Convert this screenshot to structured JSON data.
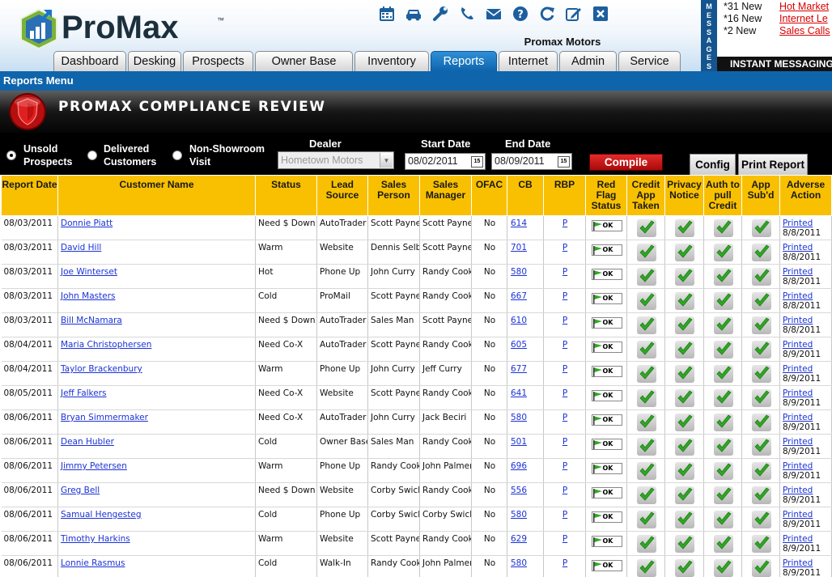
{
  "app": {
    "logo": "ProMax",
    "logo_tm": "™",
    "dealer_name": "Promax Motors"
  },
  "toolbar_icons": [
    "calendar-icon",
    "car-icon",
    "wrench-icon",
    "phone-icon",
    "mail-icon",
    "help-icon",
    "refresh-icon",
    "edit-icon",
    "close-icon"
  ],
  "tabs": [
    {
      "label": "Dashboard",
      "active": false
    },
    {
      "label": "Desking",
      "active": false
    },
    {
      "label": "Prospects",
      "active": false
    },
    {
      "label": "Owner Base",
      "active": false
    },
    {
      "label": "Inventory",
      "active": false
    },
    {
      "label": "Reports",
      "active": true
    },
    {
      "label": "Internet",
      "active": false
    },
    {
      "label": "Admin",
      "active": false
    },
    {
      "label": "Service",
      "active": false
    }
  ],
  "messages": {
    "vertical_letters": [
      "M",
      "E",
      "S",
      "S",
      "A",
      "G",
      "E",
      "S"
    ],
    "items": [
      {
        "count": "*31 New",
        "link": "Hot Market"
      },
      {
        "count": "*16 New",
        "link": "Internet Le"
      },
      {
        "count": "*2 New",
        "link": "Sales Calls"
      }
    ],
    "im_label": "INSTANT MESSAGING"
  },
  "reports_menu": "Reports Menu",
  "banner_title": "PROMAX COMPLIANCE REVIEW",
  "filters": {
    "radios": [
      {
        "line1": "Unsold",
        "line2": "Prospects",
        "checked": true
      },
      {
        "line1": "Delivered",
        "line2": "Customers",
        "checked": false
      },
      {
        "line1": "Non-Showroom",
        "line2": "Visit",
        "checked": false
      }
    ],
    "dealer_label": "Dealer",
    "dealer_value": "Hometown Motors",
    "start_label": "Start Date",
    "start_value": "08/02/2011",
    "end_label": "End Date",
    "end_value": "08/09/2011",
    "cal_icon_text": "15",
    "compile_label": "Compile",
    "config_label": "Config",
    "print_label": "Print Report"
  },
  "table": {
    "columns": [
      {
        "key": "date",
        "label": "Report Date"
      },
      {
        "key": "name",
        "label": "Customer Name"
      },
      {
        "key": "status",
        "label": "Status"
      },
      {
        "key": "lead",
        "label": "Lead Source"
      },
      {
        "key": "sp",
        "label": "Sales Person"
      },
      {
        "key": "sm",
        "label": "Sales Manager"
      },
      {
        "key": "ofac",
        "label": "OFAC"
      },
      {
        "key": "cb",
        "label": "CB"
      },
      {
        "key": "rbp",
        "label": "RBP"
      },
      {
        "key": "redflag",
        "label": "Red Flag Status"
      },
      {
        "key": "credit",
        "label": "Credit App Taken"
      },
      {
        "key": "privacy",
        "label": "Privacy Notice"
      },
      {
        "key": "auth",
        "label": "Auth to pull Credit"
      },
      {
        "key": "appsub",
        "label": "App Sub'd"
      },
      {
        "key": "adverse",
        "label": "Adverse Action"
      }
    ],
    "ok_text": "OK",
    "rows": [
      {
        "date": "08/03/2011",
        "name": "Donnie Piatt",
        "status": "Need $ Down",
        "lead": "AutoTrader",
        "sp": "Scott Payne",
        "sm": "Scott Payne",
        "ofac": "No",
        "cb": "614",
        "rbp": "P",
        "adverse": "Printed",
        "adverse_date": "8/8/2011"
      },
      {
        "date": "08/03/2011",
        "name": "David Hill",
        "status": "Warm",
        "lead": "Website",
        "sp": "Dennis Selby",
        "sm": "Scott Payne",
        "ofac": "No",
        "cb": "701",
        "rbp": "P",
        "adverse": "Printed",
        "adverse_date": "8/8/2011"
      },
      {
        "date": "08/03/2011",
        "name": "Joe Winterset",
        "status": "Hot",
        "lead": "Phone Up",
        "sp": "John Curry",
        "sm": "Randy Cook",
        "ofac": "No",
        "cb": "580",
        "rbp": "P",
        "adverse": "Printed",
        "adverse_date": "8/8/2011"
      },
      {
        "date": "08/03/2011",
        "name": "John Masters",
        "status": "Cold",
        "lead": "ProMail",
        "sp": "Scott Payne",
        "sm": "Randy Cook",
        "ofac": "No",
        "cb": "667",
        "rbp": "P",
        "adverse": "Printed",
        "adverse_date": "8/8/2011"
      },
      {
        "date": "08/03/2011",
        "name": "Bill McNamara",
        "status": "Need $ Down",
        "lead": "AutoTrader",
        "sp": "Sales Man",
        "sm": "Scott Payne",
        "ofac": "No",
        "cb": "610",
        "rbp": "P",
        "adverse": "Printed",
        "adverse_date": "8/8/2011"
      },
      {
        "date": "08/04/2011",
        "name": "Maria Christophersen",
        "status": "Need Co-X",
        "lead": "AutoTrader",
        "sp": "Scott Payne",
        "sm": "Randy Cook",
        "ofac": "No",
        "cb": "605",
        "rbp": "P",
        "adverse": "Printed",
        "adverse_date": "8/9/2011"
      },
      {
        "date": "08/04/2011",
        "name": "Taylor Brackenbury",
        "status": "Warm",
        "lead": "Phone Up",
        "sp": "John Curry",
        "sm": "Jeff Curry",
        "ofac": "No",
        "cb": "677",
        "rbp": "P",
        "adverse": "Printed",
        "adverse_date": "8/9/2011"
      },
      {
        "date": "08/05/2011",
        "name": "Jeff Falkers",
        "status": "Need Co-X",
        "lead": "Website",
        "sp": "Scott Payne",
        "sm": "Randy Cook",
        "ofac": "No",
        "cb": "641",
        "rbp": "P",
        "adverse": "Printed",
        "adverse_date": "8/9/2011"
      },
      {
        "date": "08/06/2011",
        "name": "Bryan Simmermaker",
        "status": "Need Co-X",
        "lead": "AutoTrader",
        "sp": "John Curry",
        "sm": "Jack Beciri",
        "ofac": "No",
        "cb": "580",
        "rbp": "P",
        "adverse": "Printed",
        "adverse_date": "8/9/2011"
      },
      {
        "date": "08/06/2011",
        "name": "Dean Hubler",
        "status": "Cold",
        "lead": "Owner Base",
        "sp": "Sales Man",
        "sm": "Randy Cook",
        "ofac": "No",
        "cb": "501",
        "rbp": "P",
        "adverse": "Printed",
        "adverse_date": "8/9/2011"
      },
      {
        "date": "08/06/2011",
        "name": "Jimmy Petersen",
        "status": "Warm",
        "lead": "Phone Up",
        "sp": "Randy Cook",
        "sm": "John Palmer",
        "ofac": "No",
        "cb": "696",
        "rbp": "P",
        "adverse": "Printed",
        "adverse_date": "8/9/2011"
      },
      {
        "date": "08/06/2011",
        "name": "Greg Bell",
        "status": "Need $ Down",
        "lead": "Website",
        "sp": "Corby Swick",
        "sm": "Randy Cook",
        "ofac": "No",
        "cb": "556",
        "rbp": "P",
        "adverse": "Printed",
        "adverse_date": "8/9/2011"
      },
      {
        "date": "08/06/2011",
        "name": "Samual Hengesteg",
        "status": "Cold",
        "lead": "Phone Up",
        "sp": "Corby Swick",
        "sm": "Corby Swick",
        "ofac": "No",
        "cb": "580",
        "rbp": "P",
        "adverse": "Printed",
        "adverse_date": "8/9/2011"
      },
      {
        "date": "08/06/2011",
        "name": "Timothy Harkins",
        "status": "Warm",
        "lead": "Website",
        "sp": "Scott Payne",
        "sm": "Randy Cook",
        "ofac": "No",
        "cb": "629",
        "rbp": "P",
        "adverse": "Printed",
        "adverse_date": "8/9/2011"
      },
      {
        "date": "08/06/2011",
        "name": "Lonnie Rasmus",
        "status": "Cold",
        "lead": "Walk-In",
        "sp": "Randy Cook",
        "sm": "John Palmer",
        "ofac": "No",
        "cb": "580",
        "rbp": "P",
        "adverse": "Printed",
        "adverse_date": "8/9/2011"
      }
    ]
  },
  "colors": {
    "header_yellow": "#f8c000",
    "nav_blue": "#0f65ac",
    "link_blue": "#1b32d6",
    "compile_red": "#c41616",
    "check_green": "#2fa824"
  }
}
